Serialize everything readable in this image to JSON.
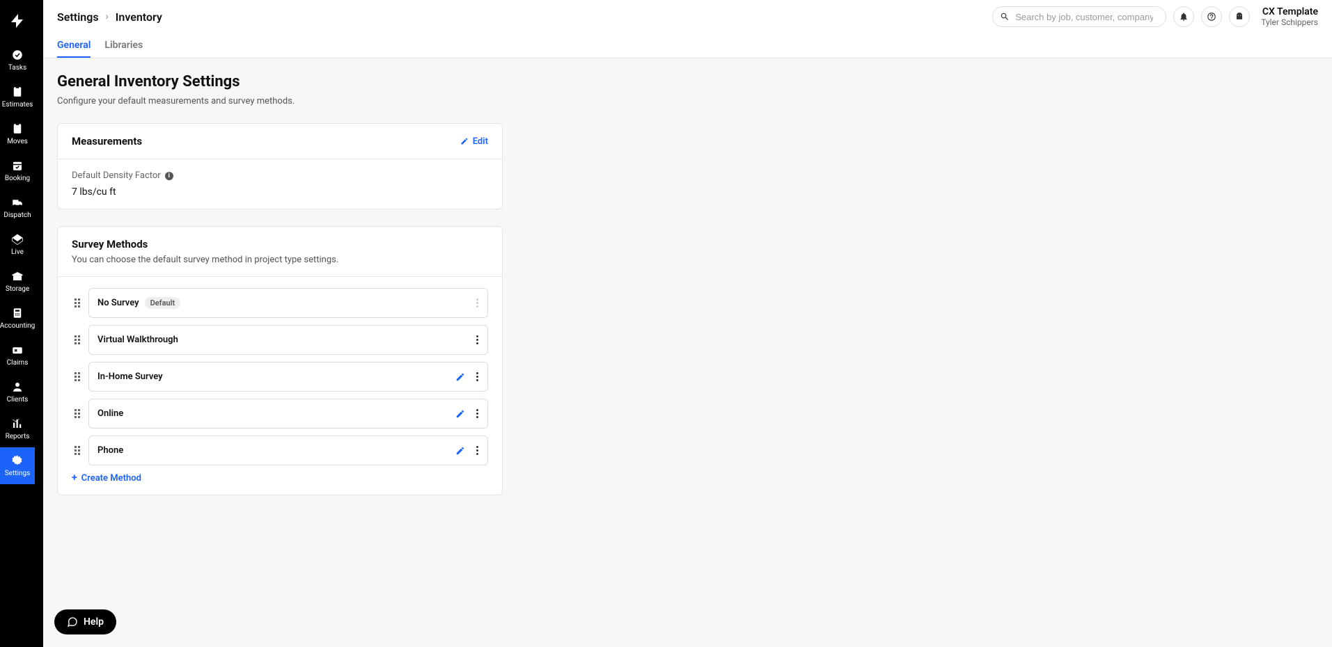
{
  "sidebar": {
    "items": [
      {
        "label": "Tasks",
        "icon": "tasks"
      },
      {
        "label": "Estimates",
        "icon": "estimates"
      },
      {
        "label": "Moves",
        "icon": "moves"
      },
      {
        "label": "Booking",
        "icon": "booking"
      },
      {
        "label": "Dispatch",
        "icon": "dispatch"
      },
      {
        "label": "Live",
        "icon": "live"
      },
      {
        "label": "Storage",
        "icon": "storage"
      },
      {
        "label": "Accounting",
        "icon": "accounting"
      },
      {
        "label": "Claims",
        "icon": "claims"
      },
      {
        "label": "Clients",
        "icon": "clients"
      },
      {
        "label": "Reports",
        "icon": "reports"
      },
      {
        "label": "Settings",
        "icon": "settings",
        "active": true
      }
    ]
  },
  "header": {
    "breadcrumb": [
      "Settings",
      "Inventory"
    ],
    "search_placeholder": "Search by job, customer, company, etc...",
    "user": {
      "org": "CX Template",
      "name": "Tyler Schippers"
    }
  },
  "tabs": [
    {
      "label": "General",
      "active": true
    },
    {
      "label": "Libraries",
      "active": false
    }
  ],
  "page": {
    "title": "General Inventory Settings",
    "description": "Configure your default measurements and survey methods."
  },
  "measurements": {
    "title": "Measurements",
    "edit_label": "Edit",
    "field_label": "Default Density Factor",
    "field_value": "7 lbs/cu ft"
  },
  "survey": {
    "title": "Survey Methods",
    "subtitle": "You can choose the default survey method in project type settings.",
    "default_badge": "Default",
    "create_label": "Create Method",
    "methods": [
      {
        "name": "No Survey",
        "is_default": true,
        "editable": false,
        "menu_enabled": false
      },
      {
        "name": "Virtual Walkthrough",
        "is_default": false,
        "editable": false,
        "menu_enabled": true
      },
      {
        "name": "In-Home Survey",
        "is_default": false,
        "editable": true,
        "menu_enabled": true
      },
      {
        "name": "Online",
        "is_default": false,
        "editable": true,
        "menu_enabled": true
      },
      {
        "name": "Phone",
        "is_default": false,
        "editable": true,
        "menu_enabled": true
      }
    ]
  },
  "help_label": "Help"
}
